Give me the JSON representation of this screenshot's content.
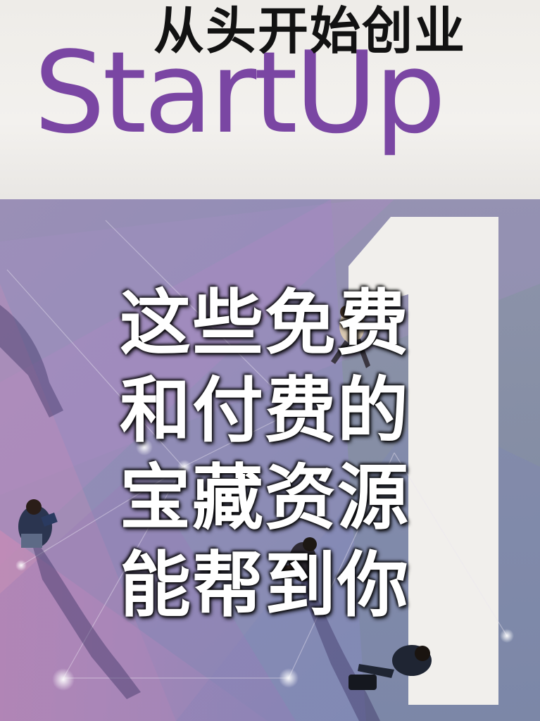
{
  "brand": {
    "title": "StartUp",
    "accent_color": "#7a46a3"
  },
  "series_title": "从头开始创业",
  "headline_lines": [
    "这些免费",
    "和付费的",
    "宝藏资源",
    "能帮到你"
  ],
  "cover_number": "1",
  "colors": {
    "header_bg": "#f0eeea",
    "text_dark": "#121212",
    "headline_text": "#ffffff"
  }
}
